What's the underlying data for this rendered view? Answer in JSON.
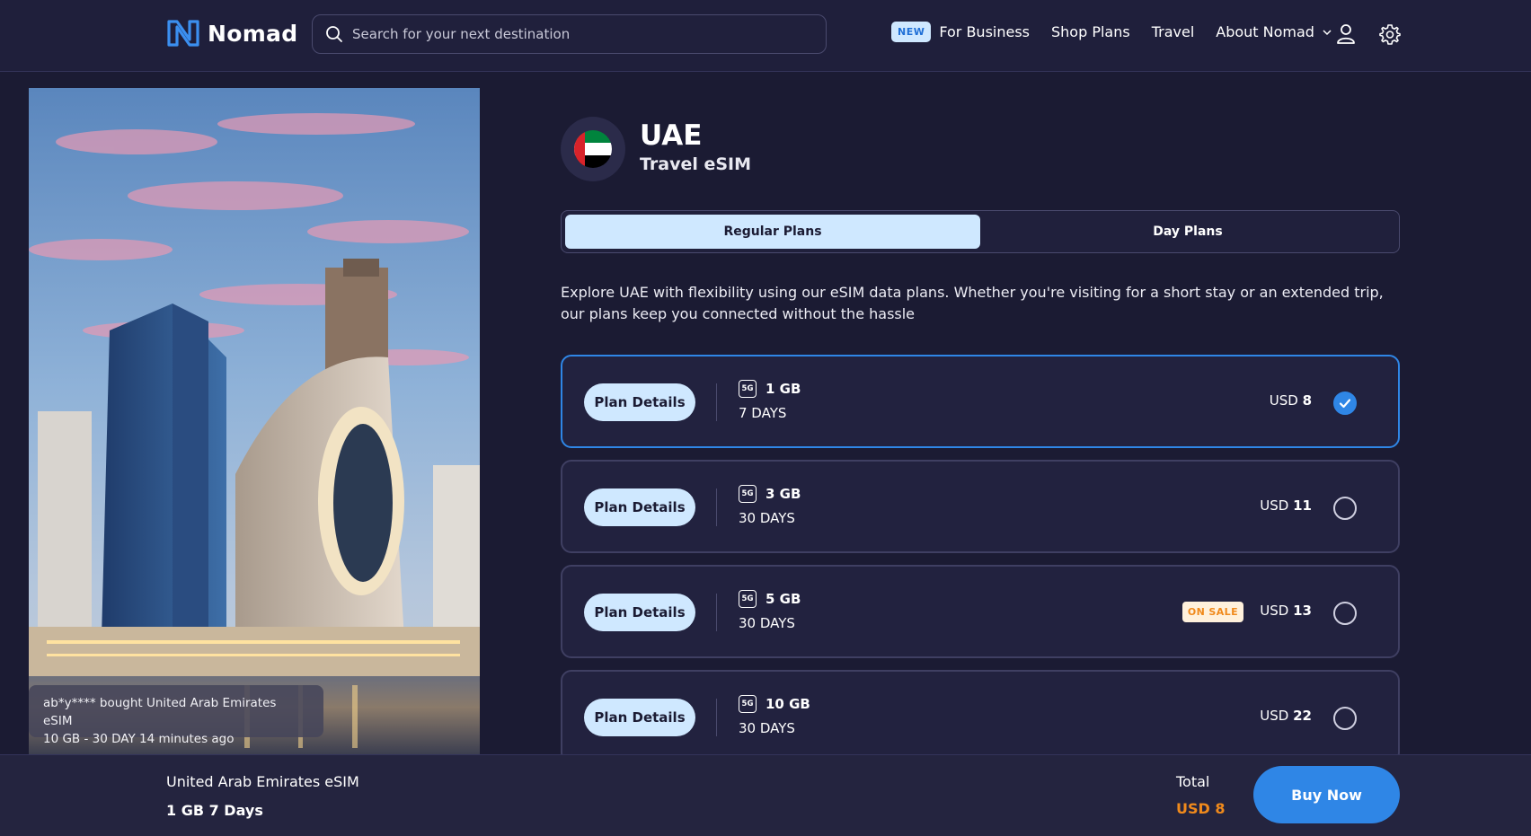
{
  "header": {
    "logo_text": "Nomad",
    "search_placeholder": "Search for your next destination",
    "new_badge": "NEW",
    "nav": [
      "For Business",
      "Shop Plans",
      "Travel",
      "About Nomad"
    ]
  },
  "hero": {
    "toast_line1": "ab*y**** bought United Arab Emirates eSIM",
    "toast_line2": "10 GB - 30 DAY 14 minutes ago"
  },
  "product": {
    "country": "UAE",
    "subtitle": "Travel eSIM"
  },
  "tabs": [
    {
      "label": "Regular Plans",
      "active": true
    },
    {
      "label": "Day Plans",
      "active": false
    }
  ],
  "description": "Explore UAE with flexibility using our eSIM data plans. Whether you're visiting for a short stay or an extended trip, our plans keep you connected without the hassle",
  "plans": [
    {
      "details_label": "Plan Details",
      "network": "5G",
      "data": "1 GB",
      "days": "7 DAYS",
      "currency": "USD",
      "price": "8",
      "selected": true,
      "badge": ""
    },
    {
      "details_label": "Plan Details",
      "network": "5G",
      "data": "3 GB",
      "days": "30 DAYS",
      "currency": "USD",
      "price": "11",
      "selected": false,
      "badge": ""
    },
    {
      "details_label": "Plan Details",
      "network": "5G",
      "data": "5 GB",
      "days": "30 DAYS",
      "currency": "USD",
      "price": "13",
      "selected": false,
      "badge": "ON SALE"
    },
    {
      "details_label": "Plan Details",
      "network": "5G",
      "data": "10 GB",
      "days": "30 DAYS",
      "currency": "USD",
      "price": "22",
      "selected": false,
      "badge": ""
    }
  ],
  "bottom_bar": {
    "product_name": "United Arab Emirates eSIM",
    "selected_plan": "1 GB 7 Days",
    "total_label": "Total",
    "total_value": "USD 8",
    "buy_label": "Buy Now"
  },
  "colors": {
    "background": "#1b1b33",
    "accent": "#2f86e6",
    "light_blue": "#cfe8ff",
    "price_orange": "#f08a1c"
  }
}
